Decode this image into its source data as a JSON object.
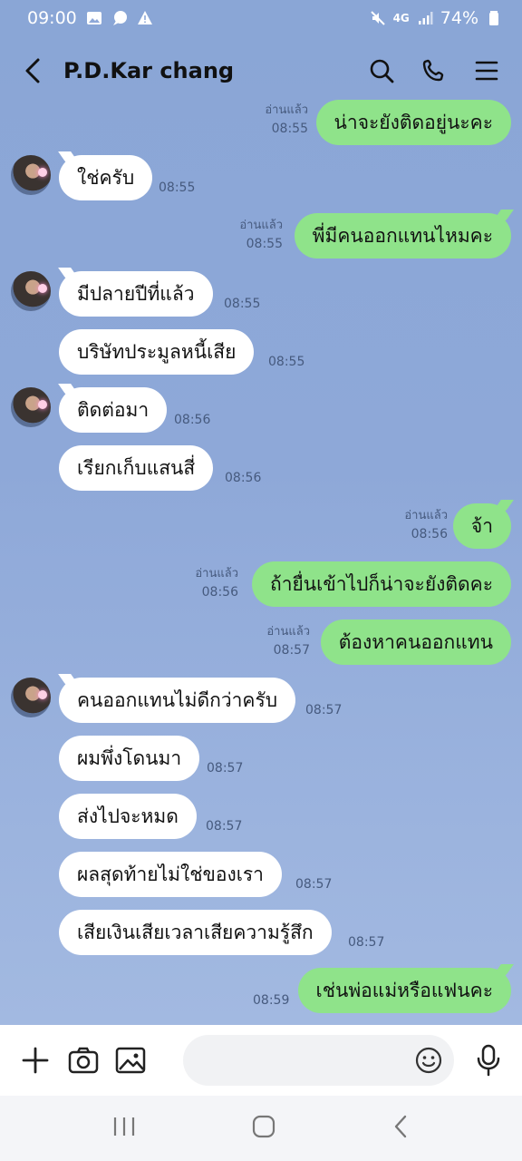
{
  "status": {
    "time": "09:00",
    "network": "4G",
    "battery": "74%"
  },
  "header": {
    "title": "P.D.Kar chang"
  },
  "messages": [
    {
      "dir": "out",
      "text": "น่าจะยังติดอยู่นะคะ",
      "read": "อ่านแล้ว",
      "time": "08:55"
    },
    {
      "dir": "in",
      "text": "ใช่ครับ",
      "time": "08:55"
    },
    {
      "dir": "out",
      "text": "พี่มีคนออกแทนไหมคะ",
      "read": "อ่านแล้ว",
      "time": "08:55"
    },
    {
      "dir": "in",
      "text": "มีปลายปีที่แล้ว",
      "time": "08:55"
    },
    {
      "dir": "in",
      "text": "บริษัทประมูลหนี้เสีย",
      "time": "08:55"
    },
    {
      "dir": "in",
      "text": "ติดต่อมา",
      "time": "08:56"
    },
    {
      "dir": "in",
      "text": "เรียกเก็บแสนสี่",
      "time": "08:56"
    },
    {
      "dir": "out",
      "text": "จ้า",
      "read": "อ่านแล้ว",
      "time": "08:56"
    },
    {
      "dir": "out",
      "text": "ถ้ายื่นเข้าไปก็น่าจะยังติดคะ",
      "read": "อ่านแล้ว",
      "time": "08:56"
    },
    {
      "dir": "out",
      "text": "ต้องหาคนออกแทน",
      "read": "อ่านแล้ว",
      "time": "08:57"
    },
    {
      "dir": "in",
      "text": "คนออกแทนไม่ดีกว่าครับ",
      "time": "08:57"
    },
    {
      "dir": "in",
      "text": "ผมพึ่งโดนมา",
      "time": "08:57"
    },
    {
      "dir": "in",
      "text": "ส่งไปจะหมด",
      "time": "08:57"
    },
    {
      "dir": "in",
      "text": "ผลสุดท้ายไม่ใช่ของเรา",
      "time": "08:57"
    },
    {
      "dir": "in",
      "text": "เสียเงินเสียเวลาเสียความรู้สึก",
      "time": "08:57"
    },
    {
      "dir": "out",
      "text": "เช่นพ่อแม่หรือแฟนคะ",
      "time": "08:59"
    }
  ],
  "colors": {
    "outgoing": "#8fe38a",
    "incoming": "#ffffff",
    "background": "#8ea8d8"
  }
}
